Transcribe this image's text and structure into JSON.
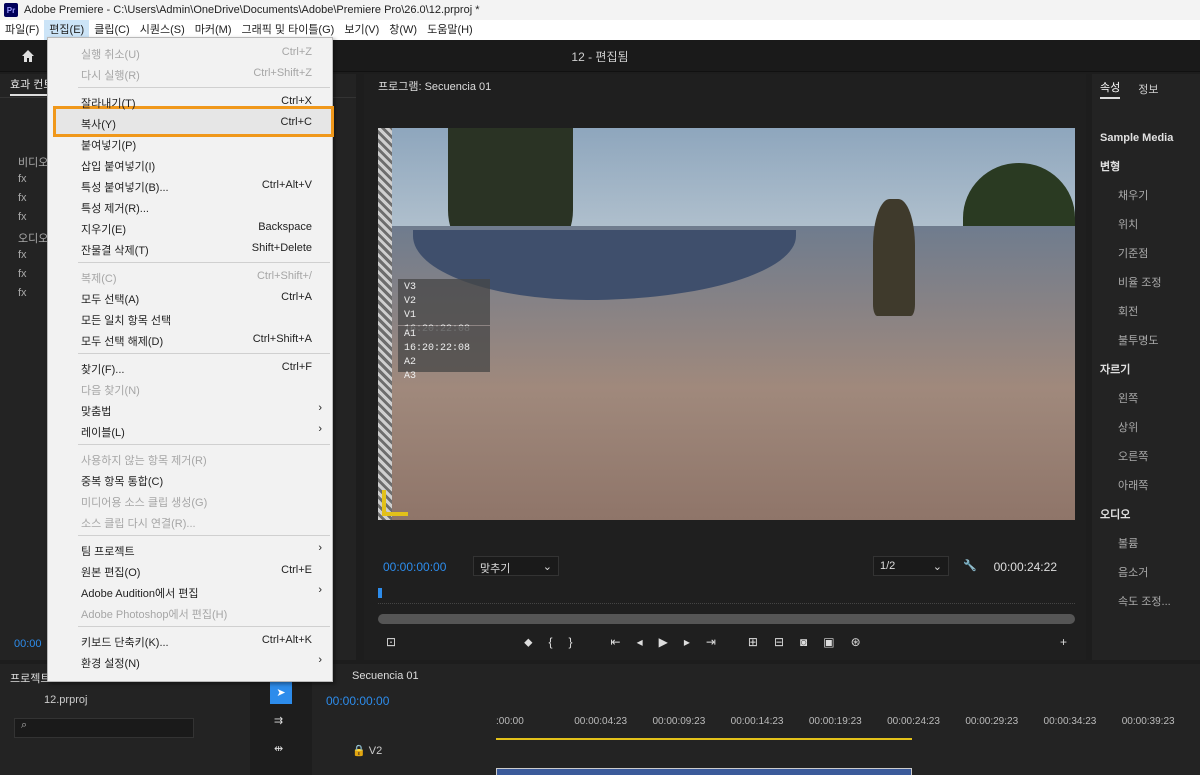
{
  "window": {
    "logo": "Pr",
    "title": "Adobe Premiere - C:\\Users\\Admin\\OneDrive\\Documents\\Adobe\\Premiere Pro\\26.0\\12.prproj *",
    "project_title": "12 - 편집됨"
  },
  "menubar": [
    "파일(F)",
    "편집(E)",
    "클립(C)",
    "시퀀스(S)",
    "마커(M)",
    "그래픽 및 타이틀(G)",
    "보기(V)",
    "창(W)",
    "도움말(H)"
  ],
  "left_panel": {
    "tab": "효과 컨트롤",
    "rows": [
      "비디오",
      "fx",
      "fx",
      "fx",
      "오디오",
      "fx",
      "fx",
      "fx"
    ],
    "timecode": "00:00"
  },
  "program": {
    "tab": "프로그램: Secuencia 01",
    "overlay_video": [
      "V3",
      "V2",
      "V1 16:20:22:08"
    ],
    "overlay_audio": [
      "A1 16:20:22:08",
      "A2",
      "A3"
    ],
    "timecode_left": "00:00:00:00",
    "fit_label": "맞추기",
    "quality_label": "1/2",
    "timecode_right": "00:00:24:22"
  },
  "right_panel": {
    "tabs": [
      "속성",
      "정보"
    ],
    "clip_name": "Sample Media",
    "transform_header": "변형",
    "transform_items": [
      "채우기",
      "위치",
      "기준점",
      "비율 조정",
      "회전",
      "불투명도"
    ],
    "crop_header": "자르기",
    "crop_items": [
      "왼쪽",
      "상위",
      "오른쪽",
      "아래쪽"
    ],
    "audio_header": "오디오",
    "audio_items": [
      "볼륨"
    ],
    "mute_label": "음소거",
    "speed_button": "속도 조정..."
  },
  "bottom_left": {
    "tab": "프로젝트",
    "file": "12.prproj"
  },
  "timeline": {
    "tab": "Secuencia 01",
    "timecode": "00:00:00:00",
    "ticks": [
      ":00:00",
      "00:00:04:23",
      "00:00:09:23",
      "00:00:14:23",
      "00:00:19:23",
      "00:00:24:23",
      "00:00:29:23",
      "00:00:34:23",
      "00:00:39:23"
    ],
    "track": "V2"
  },
  "edit_menu": {
    "items": [
      {
        "label": "실행 취소(U)",
        "shortcut": "Ctrl+Z",
        "disabled": true
      },
      {
        "label": "다시 실행(R)",
        "shortcut": "Ctrl+Shift+Z",
        "disabled": true
      },
      {
        "label": "잘라내기(T)",
        "shortcut": "Ctrl+X",
        "disabled": false
      },
      {
        "label": "복사(Y)",
        "shortcut": "Ctrl+C",
        "disabled": false
      },
      {
        "label": "붙여넣기(P)",
        "shortcut": "",
        "disabled": false
      },
      {
        "label": "삽입 붙여넣기(I)",
        "shortcut": "",
        "disabled": false
      },
      {
        "label": "특성 붙여넣기(B)...",
        "shortcut": "Ctrl+Alt+V",
        "disabled": false
      },
      {
        "label": "특성 제거(R)...",
        "shortcut": "",
        "disabled": false
      },
      {
        "label": "지우기(E)",
        "shortcut": "Backspace",
        "disabled": false
      },
      {
        "label": "잔물결 삭제(T)",
        "shortcut": "Shift+Delete",
        "disabled": false
      },
      {
        "label": "복제(C)",
        "shortcut": "Ctrl+Shift+/",
        "disabled": true
      },
      {
        "label": "모두 선택(A)",
        "shortcut": "Ctrl+A",
        "disabled": false
      },
      {
        "label": "모든 일치 항목 선택",
        "shortcut": "",
        "disabled": false
      },
      {
        "label": "모두 선택 해제(D)",
        "shortcut": "Ctrl+Shift+A",
        "disabled": false
      },
      {
        "label": "찾기(F)...",
        "shortcut": "Ctrl+F",
        "disabled": false
      },
      {
        "label": "다음 찾기(N)",
        "shortcut": "",
        "disabled": true
      },
      {
        "label": "맞춤법",
        "shortcut": "",
        "disabled": false,
        "submenu": true
      },
      {
        "label": "레이블(L)",
        "shortcut": "",
        "disabled": false,
        "submenu": true
      },
      {
        "label": "사용하지 않는 항목 제거(R)",
        "shortcut": "",
        "disabled": true
      },
      {
        "label": "중복 항목 통합(C)",
        "shortcut": "",
        "disabled": false
      },
      {
        "label": "미디어용 소스 클립 생성(G)",
        "shortcut": "",
        "disabled": true
      },
      {
        "label": "소스 클립 다시 연결(R)...",
        "shortcut": "",
        "disabled": true
      },
      {
        "label": "팀 프로젝트",
        "shortcut": "",
        "disabled": false,
        "submenu": true
      },
      {
        "label": "원본 편집(O)",
        "shortcut": "Ctrl+E",
        "disabled": false
      },
      {
        "label": "Adobe Audition에서 편집",
        "shortcut": "",
        "disabled": false,
        "submenu": true
      },
      {
        "label": "Adobe Photoshop에서 편집(H)",
        "shortcut": "",
        "disabled": true
      },
      {
        "label": "키보드 단축키(K)...",
        "shortcut": "Ctrl+Alt+K",
        "disabled": false
      },
      {
        "label": "환경 설정(N)",
        "shortcut": "",
        "disabled": false,
        "submenu": true
      }
    ],
    "highlighted_index": 3
  }
}
